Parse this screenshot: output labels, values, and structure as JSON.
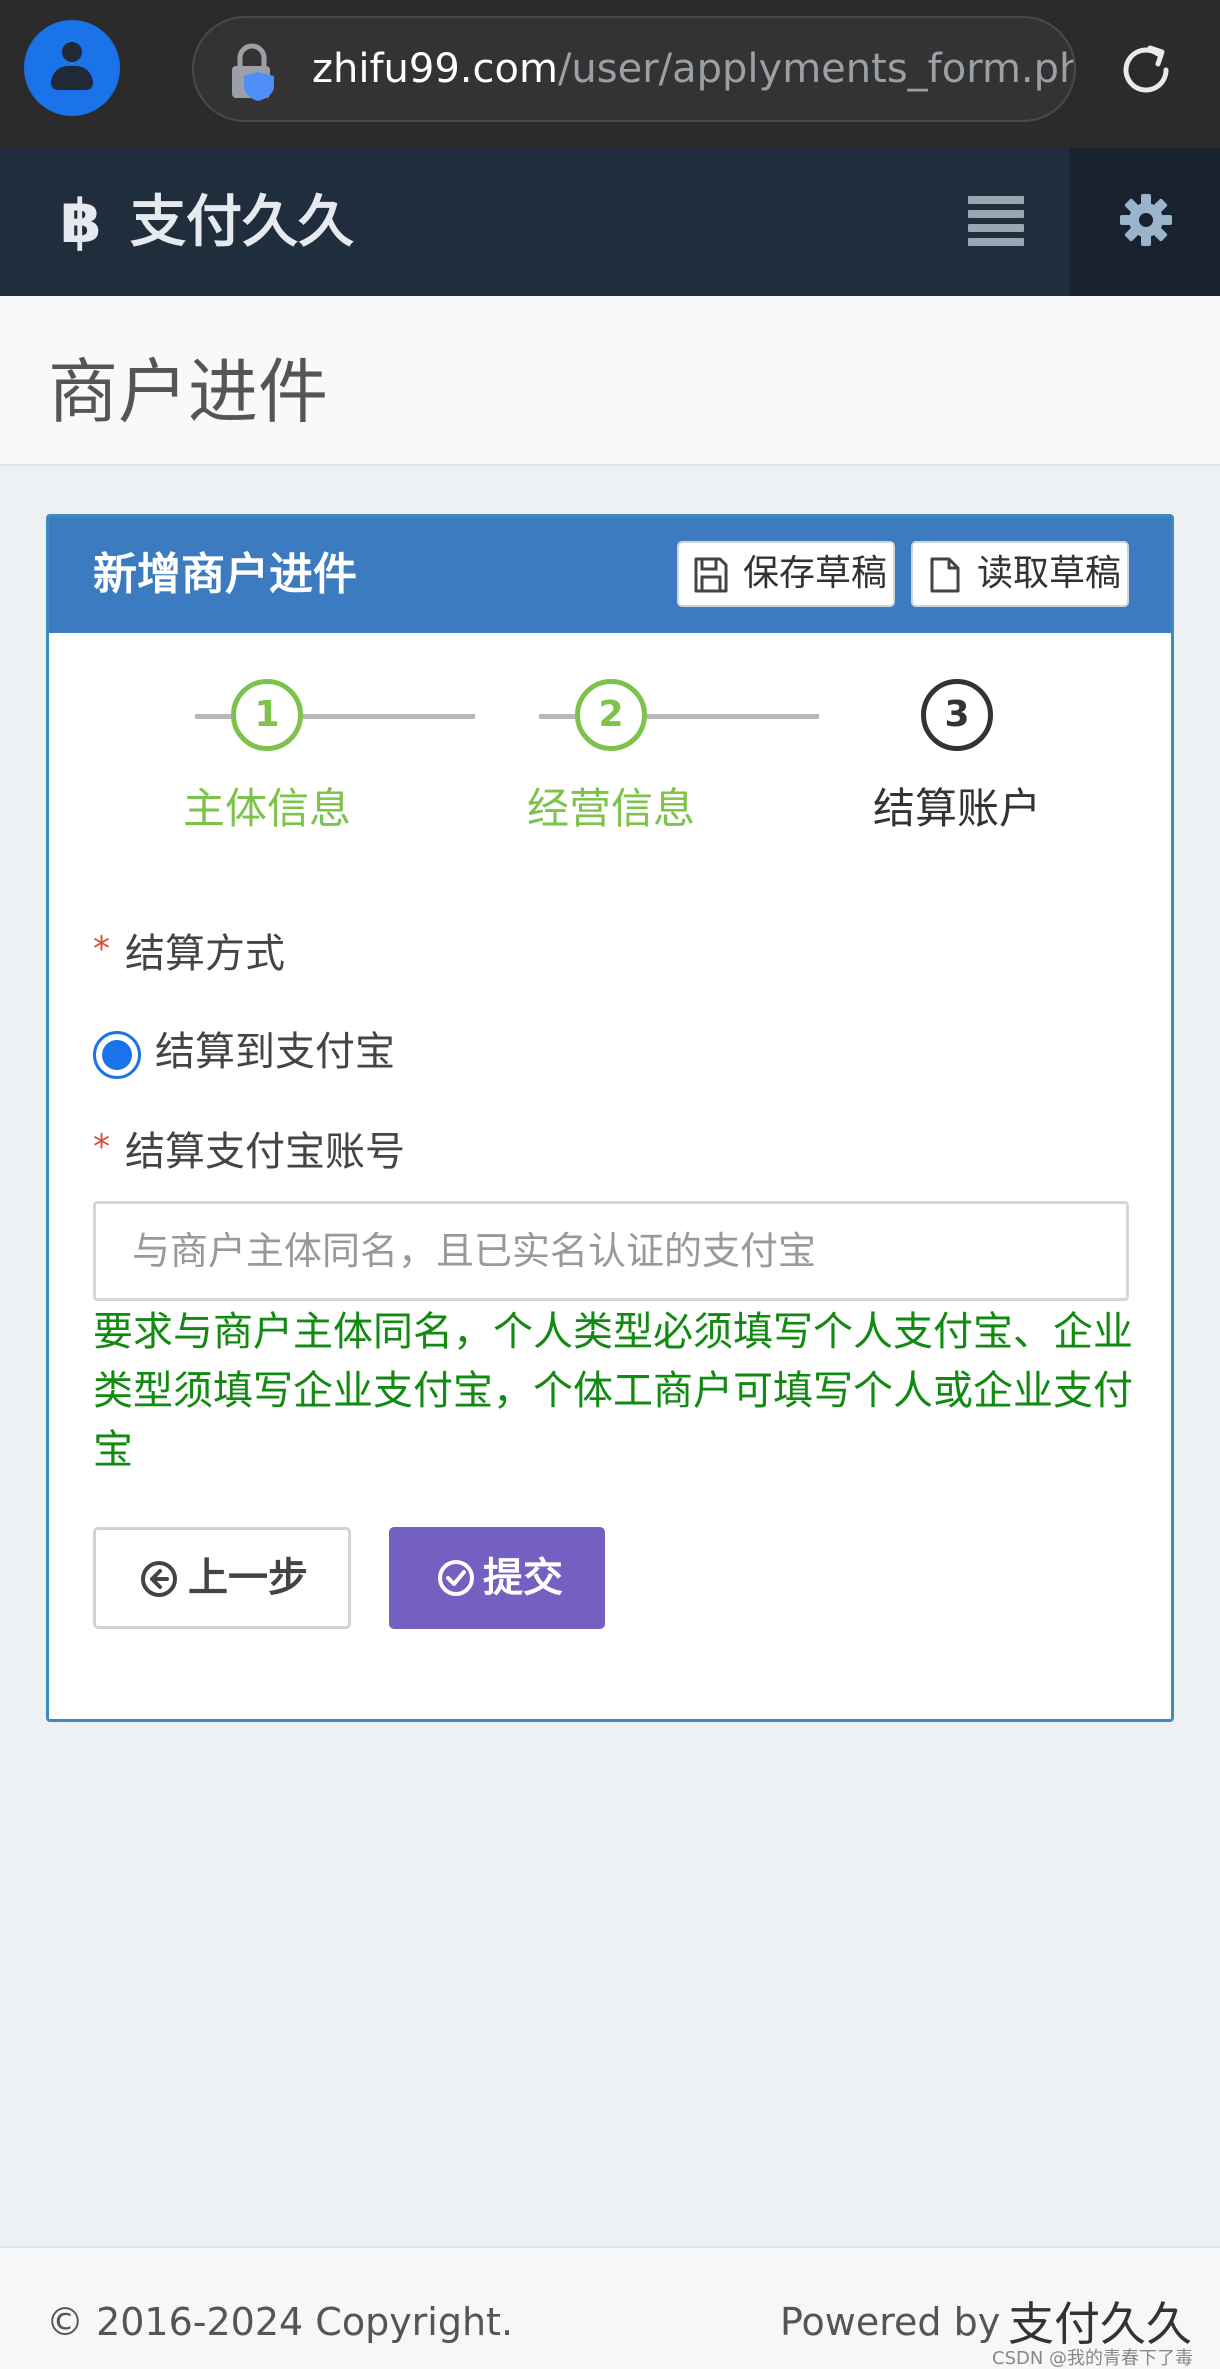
{
  "browser": {
    "url_domain": "zhifu99.com",
    "url_path": "/user/applyments_form.php"
  },
  "header": {
    "brand": "支付久久"
  },
  "page": {
    "title": "商户进件"
  },
  "panel": {
    "title": "新增商户进件",
    "save_draft": "保存草稿",
    "load_draft": "读取草稿"
  },
  "steps": [
    {
      "number": "1",
      "label": "主体信息",
      "state": "done"
    },
    {
      "number": "2",
      "label": "经营信息",
      "state": "done"
    },
    {
      "number": "3",
      "label": "结算账户",
      "state": "current"
    }
  ],
  "form": {
    "required_mark": "*",
    "settle_method_label": "结算方式",
    "settle_option": "结算到支付宝",
    "settle_option_selected": true,
    "alipay_account_label": "结算支付宝账号",
    "alipay_account_placeholder": "与商户主体同名，且已实名认证的支付宝",
    "alipay_account_value": "",
    "help_text": "要求与商户主体同名，个人类型必须填写个人支付宝、企业类型须填写企业支付宝，个体工商户可填写个人或企业支付宝",
    "prev_button": "上一步",
    "submit_button": "提交"
  },
  "footer": {
    "copyright": "© 2016-2024 Copyright.",
    "powered_by": "Powered by",
    "brand": "支付久久",
    "watermark": "CSDN @我的青春下了毒"
  },
  "colors": {
    "header_bg": "#1f2d3d",
    "panel_header_bg": "#3c7bbf",
    "step_done": "#7dc24b",
    "help_text": "#118a11",
    "submit_bg": "#7460c0",
    "required": "#dd4b39"
  },
  "icons": {
    "avatar": "user-avatar-icon",
    "lock": "lock-shield-icon",
    "reload": "reload-icon",
    "brand": "bitcoin-icon",
    "menu": "hamburger-menu-icon",
    "settings": "gear-icon",
    "save": "floppy-disk-icon",
    "load": "file-icon",
    "prev": "arrow-circle-left-icon",
    "submit": "check-circle-icon"
  }
}
